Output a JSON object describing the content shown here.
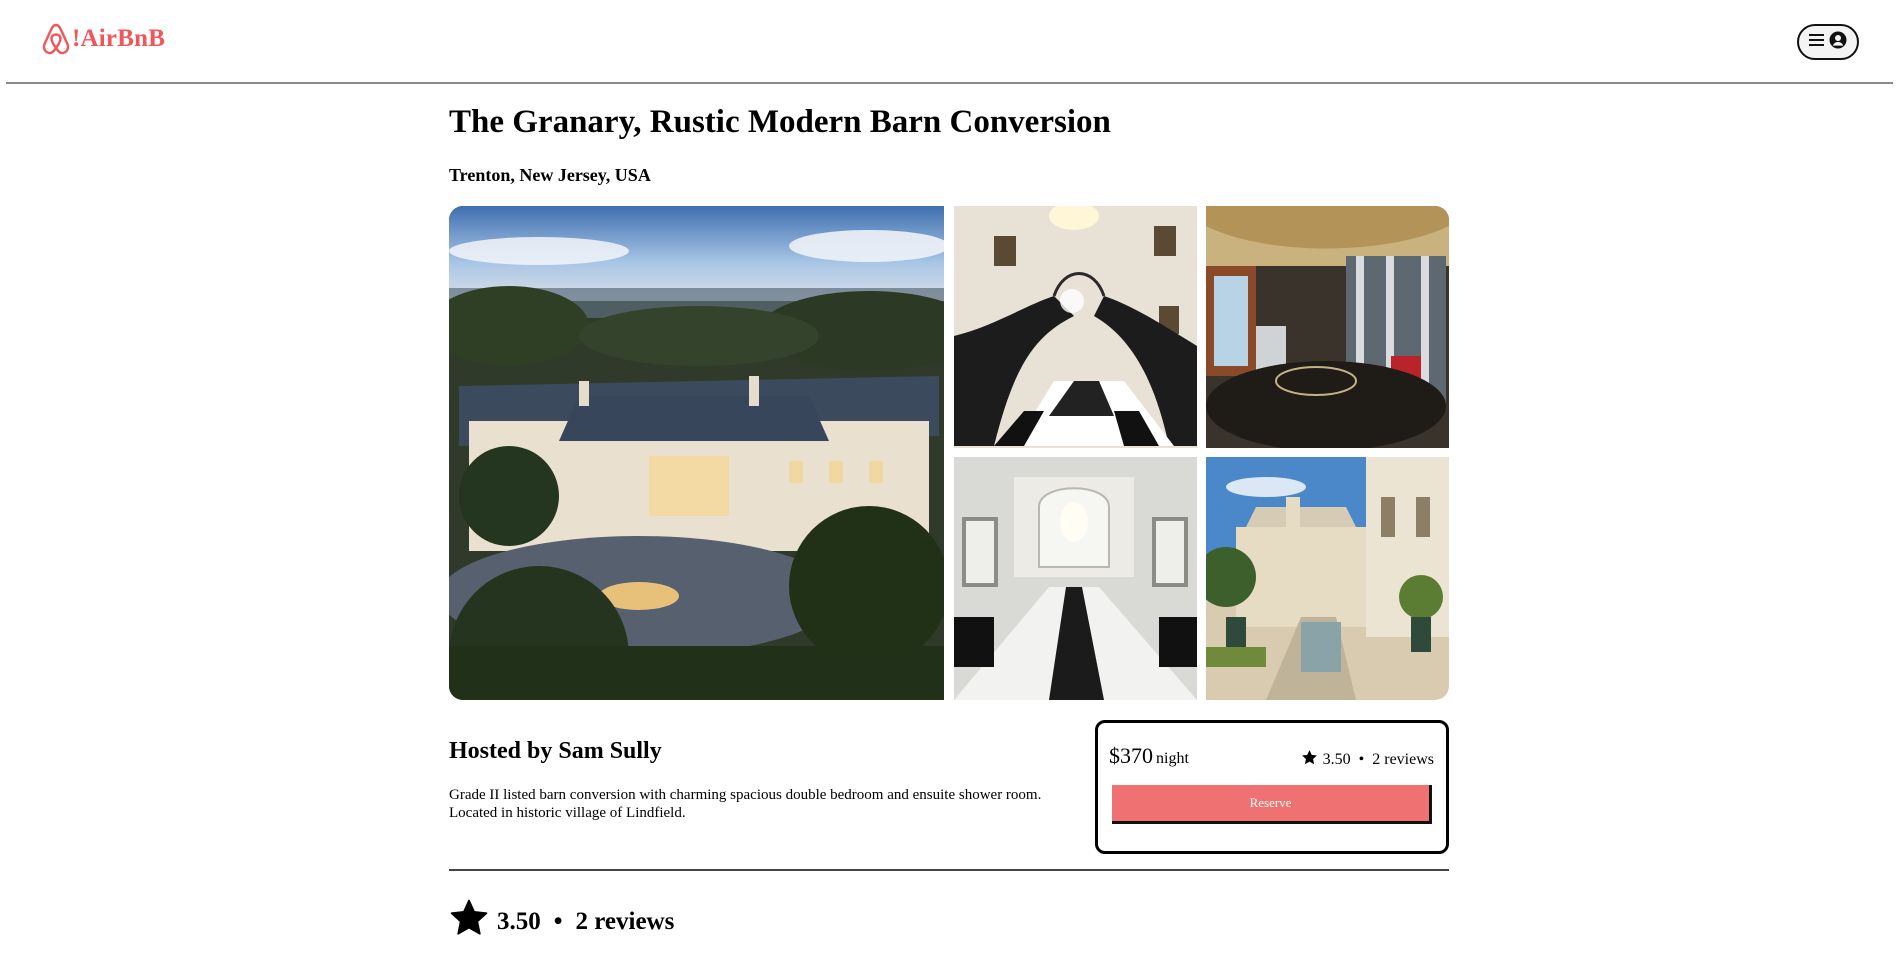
{
  "brand": {
    "logo_icon": "airbnb-belo-icon",
    "name": "!AirBnB",
    "color": "#f2555a"
  },
  "nav": {
    "menu_icon": "hamburger-icon",
    "profile_icon": "user-circle-icon"
  },
  "listing": {
    "title": "The Granary, Rustic Modern Barn Conversion",
    "location": "Trenton, New Jersey, USA",
    "photos": [
      {
        "name": "mansion-exterior-aerial-photo"
      },
      {
        "name": "grand-staircase-foyer-photo"
      },
      {
        "name": "home-gym-photo"
      },
      {
        "name": "marble-hallway-photo"
      },
      {
        "name": "courtyard-garden-photo"
      }
    ],
    "host": "Hosted by Sam Sully",
    "description": "Grade II listed barn conversion with charming spacious double bedroom and ensuite shower room. Located in historic village of Lindfield."
  },
  "booking": {
    "price": "$370",
    "unit": "night",
    "rating": "3.50",
    "separator": "•",
    "reviews": "2 reviews",
    "reserve_label": "Reserve",
    "reserve_color": "#f07172"
  },
  "reviews_section": {
    "star_icon": "star-icon",
    "rating": "3.50",
    "separator": "•",
    "reviews": "2 reviews"
  }
}
